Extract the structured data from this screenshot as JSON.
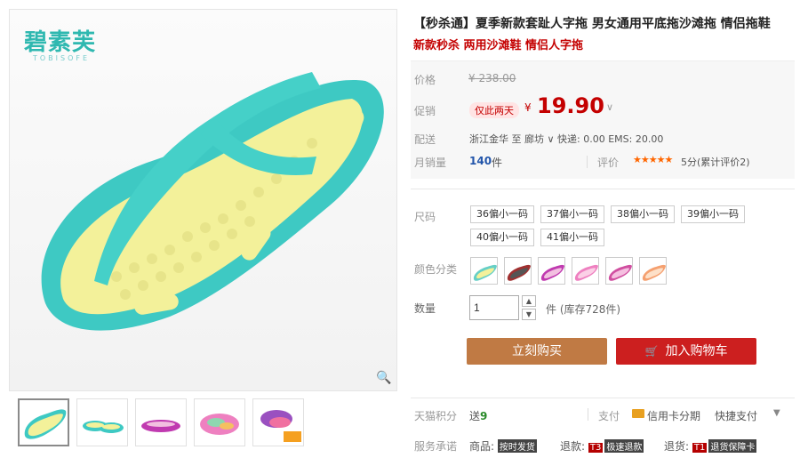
{
  "brand": {
    "name": "碧素芙",
    "sub": "TOBISOFE"
  },
  "product": {
    "title": "【秒杀通】夏季新款套趾人字拖 男女通用平底拖沙滩拖 情侣拖鞋",
    "subtitle": "新款秒杀 两用沙滩鞋 情侣人字拖"
  },
  "price": {
    "orig_label": "价格",
    "orig_price": "¥ 238.00",
    "promo_label": "促销",
    "promo_tag": "仅此两天",
    "currency": "¥",
    "value": "19.90",
    "shipping_label": "配送",
    "shipping_text": "浙江金华  至  廊坊 ∨  快递: 0.00 EMS: 20.00",
    "sales_label": "月销量",
    "sales_value": "140",
    "sales_unit": "件",
    "review_label": "评价",
    "stars": "★★★★★",
    "review_text": "5分(累计评价2)"
  },
  "size": {
    "label": "尺码",
    "options": [
      "36偏小一码",
      "37偏小一码",
      "38偏小一码",
      "39偏小一码",
      "40偏小一码",
      "41偏小一码"
    ]
  },
  "color": {
    "label": "颜色分类",
    "swatches": [
      "#66cfc6",
      "#a03030",
      "#c03ab0",
      "#ee80c0",
      "#d04fa0",
      "#f5a070"
    ]
  },
  "quantity": {
    "label": "数量",
    "value": "1",
    "stock": "件 (库存728件)"
  },
  "buttons": {
    "buy": "立刻购买",
    "cart": "加入购物车"
  },
  "points": {
    "label": "天猫积分",
    "value_prefix": "送",
    "value": "9",
    "pay_label": "支付",
    "card_text": "信用卡分期",
    "quick_pay": "快捷支付"
  },
  "service": {
    "label": "服务承诺",
    "items": [
      {
        "prefix": "商品",
        "tag": "",
        "text": "按时发货"
      },
      {
        "prefix": "退款",
        "tag": "T3",
        "text": "极速退款"
      },
      {
        "prefix": "退货",
        "tag": "T1",
        "text": "退货保障卡"
      }
    ]
  },
  "colors": {
    "price_red": "#c40000",
    "buy_button": "#c07a44",
    "cart_button": "#cc1f1f",
    "shoe_teal": "#3ec9c3",
    "shoe_yellow": "#f3f19a"
  }
}
